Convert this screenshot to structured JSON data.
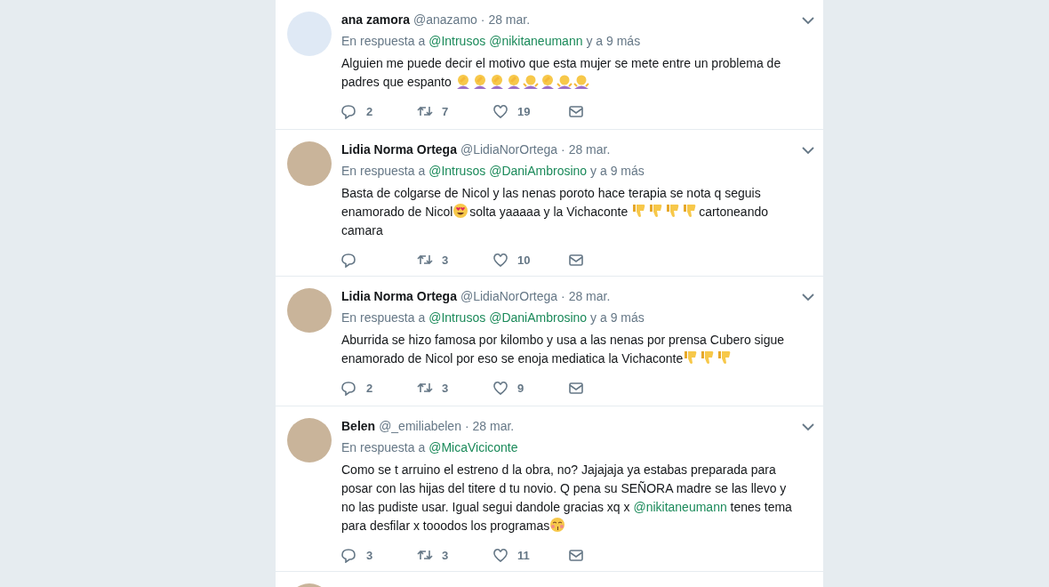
{
  "tweets": [
    {
      "name": "ana zamora",
      "handle": "@anazamo",
      "date": "· 28 mar.",
      "reply_prefix": "En respuesta a",
      "reply_to": [
        "@Intrusos",
        "@nikitaneumann"
      ],
      "reply_suffix": "y a 9 más",
      "body": [
        {
          "kind": "text",
          "text": "Alguien me puede decir el motivo que esta mujer se mete entre un problema de padres que espanto "
        },
        {
          "kind": "facepalm"
        },
        {
          "kind": "facepalm"
        },
        {
          "kind": "facepalm"
        },
        {
          "kind": "facepalm"
        },
        {
          "kind": "shrug"
        },
        {
          "kind": "facepalm"
        },
        {
          "kind": "shrug"
        },
        {
          "kind": "shrug"
        }
      ],
      "replies": "2",
      "retweets": "7",
      "likes": "19"
    },
    {
      "name": "Lidia Norma Ortega",
      "handle": "@LidiaNorOrtega",
      "date": "· 28 mar.",
      "reply_prefix": "En respuesta a",
      "reply_to": [
        "@Intrusos",
        "@DaniAmbrosino"
      ],
      "reply_suffix": "y a 9 más",
      "body": [
        {
          "kind": "text",
          "text": "Basta de colgarse de Nicol y las nenas poroto hace terapia se nota q seguis enamorado de Nicol"
        },
        {
          "kind": "hearteyes"
        },
        {
          "kind": "text",
          "text": "solta yaaaaa y la Vichaconte "
        },
        {
          "kind": "thumbsdown"
        },
        {
          "kind": "thumbsdown"
        },
        {
          "kind": "thumbsdown"
        },
        {
          "kind": "thumbsdown"
        },
        {
          "kind": "text",
          "text": "cartoneando camara"
        }
      ],
      "retweets": "3",
      "likes": "10"
    },
    {
      "name": "Lidia Norma Ortega",
      "handle": "@LidiaNorOrtega",
      "date": "· 28 mar.",
      "reply_prefix": "En respuesta a",
      "reply_to": [
        "@Intrusos",
        "@DaniAmbrosino"
      ],
      "reply_suffix": "y a 9 más",
      "body": [
        {
          "kind": "text",
          "text": "Aburrida se hizo famosa por kilombo y usa a las nenas por prensa Cubero sigue enamorado de Nicol por eso se enoja mediatica la Vichaconte"
        },
        {
          "kind": "thumbsdown"
        },
        {
          "kind": "thumbsdown"
        },
        {
          "kind": "thumbsdown"
        }
      ],
      "replies": "2",
      "retweets": "3",
      "likes": "9"
    },
    {
      "name": "Belen",
      "handle": "@_emiliabelen",
      "date": "· 28 mar.",
      "reply_prefix": "En respuesta a",
      "reply_to": [
        "@MicaViciconte"
      ],
      "body": [
        {
          "kind": "text",
          "text": "Como se t arruino el estreno d la obra, no? Jajajaja ya estabas preparada para posar con las hijas del titere d tu novio. Q pena su SEÑORA madre se las llevo y no las pudiste usar. Igual segui dandole gracias xq x "
        },
        {
          "kind": "mention",
          "text": "@nikitaneumann"
        },
        {
          "kind": "text",
          "text": " tenes tema para desfilar x tooodos los programas"
        },
        {
          "kind": "kiss"
        }
      ],
      "replies": "3",
      "retweets": "3",
      "likes": "11"
    }
  ]
}
